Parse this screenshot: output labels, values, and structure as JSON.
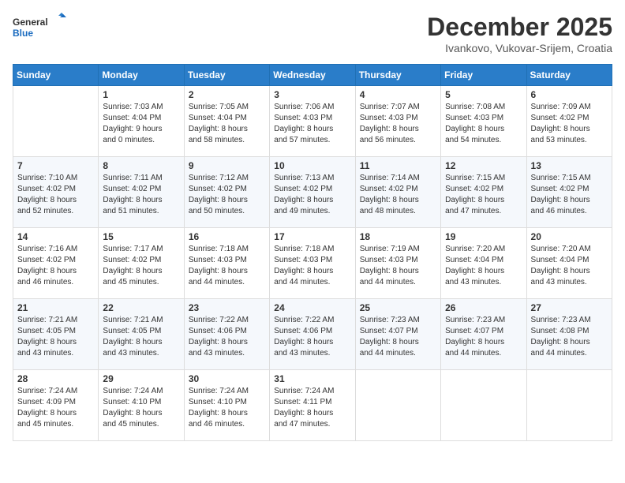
{
  "logo": {
    "line1": "General",
    "line2": "Blue"
  },
  "title": "December 2025",
  "location": "Ivankovo, Vukovar-Srijem, Croatia",
  "weekdays": [
    "Sunday",
    "Monday",
    "Tuesday",
    "Wednesday",
    "Thursday",
    "Friday",
    "Saturday"
  ],
  "weeks": [
    [
      {
        "day": "",
        "info": ""
      },
      {
        "day": "1",
        "info": "Sunrise: 7:03 AM\nSunset: 4:04 PM\nDaylight: 9 hours\nand 0 minutes."
      },
      {
        "day": "2",
        "info": "Sunrise: 7:05 AM\nSunset: 4:04 PM\nDaylight: 8 hours\nand 58 minutes."
      },
      {
        "day": "3",
        "info": "Sunrise: 7:06 AM\nSunset: 4:03 PM\nDaylight: 8 hours\nand 57 minutes."
      },
      {
        "day": "4",
        "info": "Sunrise: 7:07 AM\nSunset: 4:03 PM\nDaylight: 8 hours\nand 56 minutes."
      },
      {
        "day": "5",
        "info": "Sunrise: 7:08 AM\nSunset: 4:03 PM\nDaylight: 8 hours\nand 54 minutes."
      },
      {
        "day": "6",
        "info": "Sunrise: 7:09 AM\nSunset: 4:02 PM\nDaylight: 8 hours\nand 53 minutes."
      }
    ],
    [
      {
        "day": "7",
        "info": "Sunrise: 7:10 AM\nSunset: 4:02 PM\nDaylight: 8 hours\nand 52 minutes."
      },
      {
        "day": "8",
        "info": "Sunrise: 7:11 AM\nSunset: 4:02 PM\nDaylight: 8 hours\nand 51 minutes."
      },
      {
        "day": "9",
        "info": "Sunrise: 7:12 AM\nSunset: 4:02 PM\nDaylight: 8 hours\nand 50 minutes."
      },
      {
        "day": "10",
        "info": "Sunrise: 7:13 AM\nSunset: 4:02 PM\nDaylight: 8 hours\nand 49 minutes."
      },
      {
        "day": "11",
        "info": "Sunrise: 7:14 AM\nSunset: 4:02 PM\nDaylight: 8 hours\nand 48 minutes."
      },
      {
        "day": "12",
        "info": "Sunrise: 7:15 AM\nSunset: 4:02 PM\nDaylight: 8 hours\nand 47 minutes."
      },
      {
        "day": "13",
        "info": "Sunrise: 7:15 AM\nSunset: 4:02 PM\nDaylight: 8 hours\nand 46 minutes."
      }
    ],
    [
      {
        "day": "14",
        "info": "Sunrise: 7:16 AM\nSunset: 4:02 PM\nDaylight: 8 hours\nand 46 minutes."
      },
      {
        "day": "15",
        "info": "Sunrise: 7:17 AM\nSunset: 4:02 PM\nDaylight: 8 hours\nand 45 minutes."
      },
      {
        "day": "16",
        "info": "Sunrise: 7:18 AM\nSunset: 4:03 PM\nDaylight: 8 hours\nand 44 minutes."
      },
      {
        "day": "17",
        "info": "Sunrise: 7:18 AM\nSunset: 4:03 PM\nDaylight: 8 hours\nand 44 minutes."
      },
      {
        "day": "18",
        "info": "Sunrise: 7:19 AM\nSunset: 4:03 PM\nDaylight: 8 hours\nand 44 minutes."
      },
      {
        "day": "19",
        "info": "Sunrise: 7:20 AM\nSunset: 4:04 PM\nDaylight: 8 hours\nand 43 minutes."
      },
      {
        "day": "20",
        "info": "Sunrise: 7:20 AM\nSunset: 4:04 PM\nDaylight: 8 hours\nand 43 minutes."
      }
    ],
    [
      {
        "day": "21",
        "info": "Sunrise: 7:21 AM\nSunset: 4:05 PM\nDaylight: 8 hours\nand 43 minutes."
      },
      {
        "day": "22",
        "info": "Sunrise: 7:21 AM\nSunset: 4:05 PM\nDaylight: 8 hours\nand 43 minutes."
      },
      {
        "day": "23",
        "info": "Sunrise: 7:22 AM\nSunset: 4:06 PM\nDaylight: 8 hours\nand 43 minutes."
      },
      {
        "day": "24",
        "info": "Sunrise: 7:22 AM\nSunset: 4:06 PM\nDaylight: 8 hours\nand 43 minutes."
      },
      {
        "day": "25",
        "info": "Sunrise: 7:23 AM\nSunset: 4:07 PM\nDaylight: 8 hours\nand 44 minutes."
      },
      {
        "day": "26",
        "info": "Sunrise: 7:23 AM\nSunset: 4:07 PM\nDaylight: 8 hours\nand 44 minutes."
      },
      {
        "day": "27",
        "info": "Sunrise: 7:23 AM\nSunset: 4:08 PM\nDaylight: 8 hours\nand 44 minutes."
      }
    ],
    [
      {
        "day": "28",
        "info": "Sunrise: 7:24 AM\nSunset: 4:09 PM\nDaylight: 8 hours\nand 45 minutes."
      },
      {
        "day": "29",
        "info": "Sunrise: 7:24 AM\nSunset: 4:10 PM\nDaylight: 8 hours\nand 45 minutes."
      },
      {
        "day": "30",
        "info": "Sunrise: 7:24 AM\nSunset: 4:10 PM\nDaylight: 8 hours\nand 46 minutes."
      },
      {
        "day": "31",
        "info": "Sunrise: 7:24 AM\nSunset: 4:11 PM\nDaylight: 8 hours\nand 47 minutes."
      },
      {
        "day": "",
        "info": ""
      },
      {
        "day": "",
        "info": ""
      },
      {
        "day": "",
        "info": ""
      }
    ]
  ]
}
